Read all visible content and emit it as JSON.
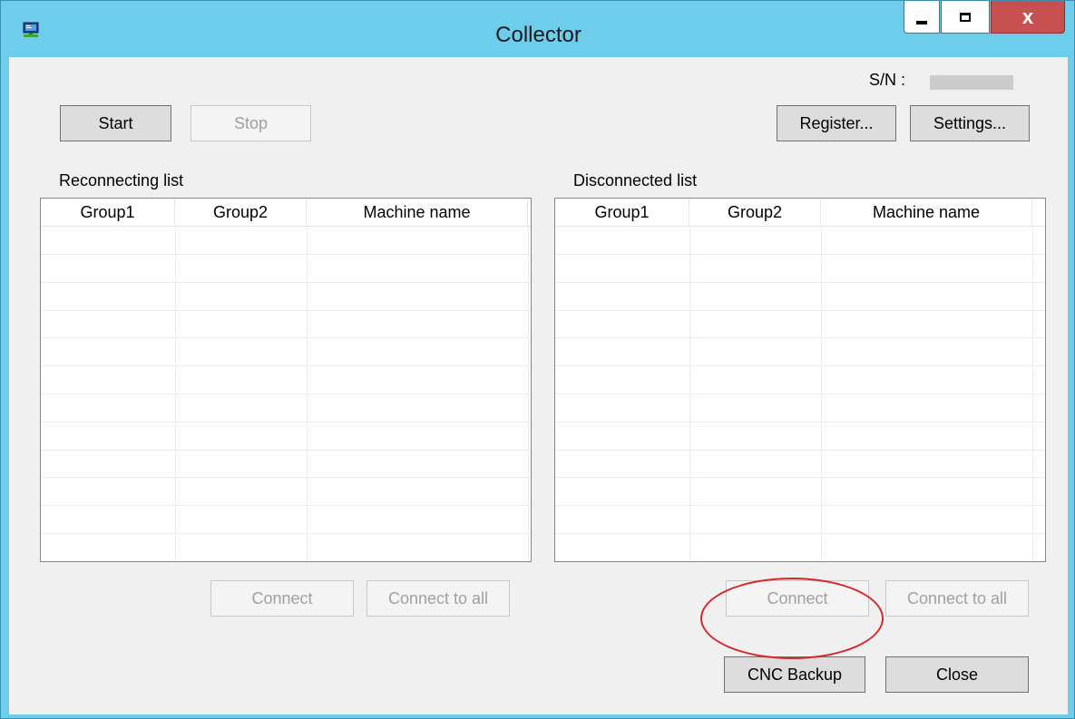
{
  "window": {
    "title": "Collector",
    "controls": {
      "minimize": "minimize",
      "maximize": "maximize",
      "close": "x"
    }
  },
  "serial": {
    "label": "S/N :",
    "value_redacted": true
  },
  "toolbar": {
    "start": "Start",
    "stop": "Stop",
    "register": "Register...",
    "settings": "Settings..."
  },
  "reconnecting": {
    "title": "Reconnecting list",
    "columns": [
      "Group1",
      "Group2",
      "Machine name"
    ],
    "rows": [],
    "connect": "Connect",
    "connect_all": "Connect to all"
  },
  "disconnected": {
    "title": "Disconnected list",
    "columns": [
      "Group1",
      "Group2",
      "Machine name"
    ],
    "rows": [],
    "connect": "Connect",
    "connect_all": "Connect to all"
  },
  "footer": {
    "cnc_backup": "CNC Backup",
    "close": "Close"
  },
  "colors": {
    "titlebar": "#6dcdea",
    "close_button": "#c75050",
    "annotation": "#d9262a"
  }
}
